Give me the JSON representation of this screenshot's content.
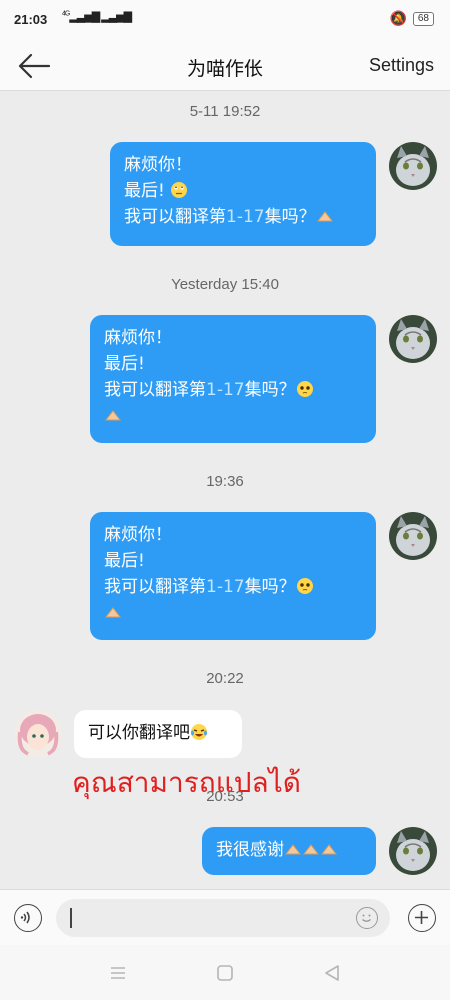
{
  "status": {
    "time": "21:03",
    "network": "4G",
    "battery": "68"
  },
  "header": {
    "title": "为喵作伥",
    "settings_label": "Settings"
  },
  "timestamps": [
    "5-11 19:52",
    "Yesterday 15:40",
    "19:36",
    "20:22",
    "20:53"
  ],
  "messages": [
    {
      "direction": "out",
      "line1": "麻烦你！",
      "line2": "最后!",
      "line3_pre": "我可以翻译第",
      "line3_num": "1-17",
      "line3_post": "集吗？"
    },
    {
      "direction": "out",
      "line1": "麻烦你！",
      "line2": "最后!",
      "line3_pre": "我可以翻译第",
      "line3_num": "1-17",
      "line3_post": "集吗？"
    },
    {
      "direction": "out",
      "line1": "麻烦你！",
      "line2": "最后!",
      "line3_pre": "我可以翻译第",
      "line3_num": "1-17",
      "line3_post": "集吗？"
    },
    {
      "direction": "in",
      "text": "可以你翻译吧"
    },
    {
      "direction": "out",
      "text": "我很感谢"
    }
  ],
  "overlay_text": "คุณสามารถแปลได้",
  "input": {
    "value": ""
  },
  "colors": {
    "bubble_out": "#2e9cf4",
    "bubble_in": "#ffffff",
    "overlay_text": "#e0201f",
    "background": "#ececec"
  },
  "icons": [
    "back-arrow-icon",
    "voice-icon",
    "emoji-icon",
    "plus-icon",
    "menu-icon",
    "home-icon",
    "back-triangle-icon"
  ]
}
